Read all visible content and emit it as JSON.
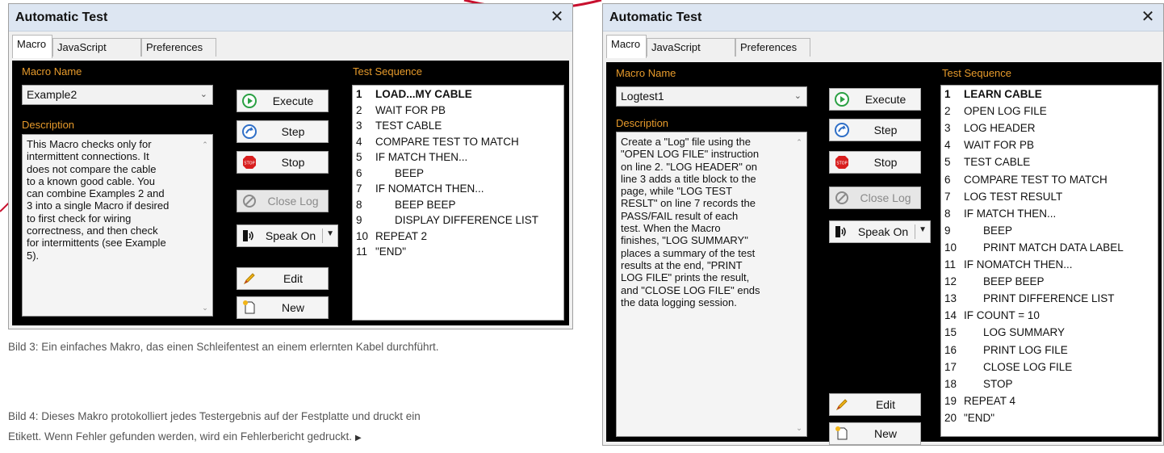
{
  "left_dialog": {
    "title": "Automatic Test",
    "close_label": "✕",
    "tabs": [
      "Macro",
      "JavaScript",
      "Preferences"
    ],
    "macro_name_label": "Macro Name",
    "macro_name_value": "Example2",
    "description_label": "Description",
    "description_lines": [
      "This Macro checks only for",
      "intermittent connections. It",
      "does not compare the cable",
      "to a known good cable. You",
      "can combine Examples 2 and",
      "3 into a single Macro if desired",
      "to first check for wiring",
      "correctness, and then check",
      "for intermittents (see Example",
      "5)."
    ],
    "buttons": {
      "execute": "Execute",
      "step": "Step",
      "stop": "Stop",
      "close_log": "Close Log",
      "speak_on": "Speak On",
      "edit": "Edit",
      "new": "New"
    },
    "test_sequence_label": "Test Sequence",
    "sequence": [
      {
        "n": "1",
        "text": "LOAD...MY CABLE",
        "indent": 0,
        "bold": true
      },
      {
        "n": "2",
        "text": "WAIT FOR PB",
        "indent": 0,
        "bold": false
      },
      {
        "n": "3",
        "text": "TEST CABLE",
        "indent": 0,
        "bold": false
      },
      {
        "n": "4",
        "text": "COMPARE TEST TO MATCH",
        "indent": 0,
        "bold": false
      },
      {
        "n": "5",
        "text": "IF MATCH THEN...",
        "indent": 0,
        "bold": false
      },
      {
        "n": "6",
        "text": "BEEP",
        "indent": 1,
        "bold": false
      },
      {
        "n": "7",
        "text": "IF NOMATCH THEN...",
        "indent": 0,
        "bold": false
      },
      {
        "n": "8",
        "text": "BEEP BEEP",
        "indent": 1,
        "bold": false
      },
      {
        "n": "9",
        "text": "DISPLAY DIFFERENCE LIST",
        "indent": 1,
        "bold": false
      },
      {
        "n": "10",
        "text": "REPEAT 2",
        "indent": 0,
        "bold": false
      },
      {
        "n": "11",
        "text": "\"END\"",
        "indent": 0,
        "bold": false
      }
    ]
  },
  "right_dialog": {
    "title": "Automatic Test",
    "close_label": "✕",
    "tabs": [
      "Macro",
      "JavaScript",
      "Preferences"
    ],
    "macro_name_label": "Macro Name",
    "macro_name_value": "Logtest1",
    "description_label": "Description",
    "description_lines": [
      "Create a \"Log\" file using the",
      "\"OPEN LOG FILE\" instruction",
      "on line 2. \"LOG HEADER\" on",
      "line 3 adds a title block to the",
      "page, while \"LOG TEST",
      "RESLT\" on line 7 records the",
      "PASS/FAIL result of each",
      "test. When the Macro",
      "finishes, \"LOG SUMMARY\"",
      "places a summary of the test",
      "results at the end, \"PRINT",
      "LOG FILE\" prints the result,",
      "and \"CLOSE LOG FILE\" ends",
      "the data logging session."
    ],
    "buttons": {
      "execute": "Execute",
      "step": "Step",
      "stop": "Stop",
      "close_log": "Close Log",
      "speak_on": "Speak On",
      "edit": "Edit",
      "new": "New"
    },
    "test_sequence_label": "Test Sequence",
    "sequence": [
      {
        "n": "1",
        "text": "LEARN CABLE",
        "indent": 0,
        "bold": true
      },
      {
        "n": "2",
        "text": "OPEN LOG FILE",
        "indent": 0,
        "bold": false
      },
      {
        "n": "3",
        "text": "LOG HEADER",
        "indent": 0,
        "bold": false
      },
      {
        "n": "4",
        "text": "WAIT FOR PB",
        "indent": 0,
        "bold": false
      },
      {
        "n": "5",
        "text": "TEST CABLE",
        "indent": 0,
        "bold": false
      },
      {
        "n": "6",
        "text": "COMPARE TEST TO MATCH",
        "indent": 0,
        "bold": false
      },
      {
        "n": "7",
        "text": "LOG TEST RESULT",
        "indent": 0,
        "bold": false
      },
      {
        "n": "8",
        "text": "IF MATCH THEN...",
        "indent": 0,
        "bold": false
      },
      {
        "n": "9",
        "text": "BEEP",
        "indent": 1,
        "bold": false
      },
      {
        "n": "10",
        "text": "PRINT MATCH DATA LABEL",
        "indent": 1,
        "bold": false
      },
      {
        "n": "11",
        "text": "IF NOMATCH THEN...",
        "indent": 0,
        "bold": false
      },
      {
        "n": "12",
        "text": "BEEP BEEP",
        "indent": 1,
        "bold": false
      },
      {
        "n": "13",
        "text": "PRINT DIFFERENCE LIST",
        "indent": 1,
        "bold": false
      },
      {
        "n": "14",
        "text": "IF COUNT = 10",
        "indent": 0,
        "bold": false
      },
      {
        "n": "15",
        "text": "LOG SUMMARY",
        "indent": 1,
        "bold": false
      },
      {
        "n": "16",
        "text": "PRINT LOG FILE",
        "indent": 1,
        "bold": false
      },
      {
        "n": "17",
        "text": "CLOSE LOG FILE",
        "indent": 1,
        "bold": false
      },
      {
        "n": "18",
        "text": "STOP",
        "indent": 1,
        "bold": false
      },
      {
        "n": "19",
        "text": "REPEAT 4",
        "indent": 0,
        "bold": false
      },
      {
        "n": "20",
        "text": "\"END\"",
        "indent": 0,
        "bold": false
      }
    ]
  },
  "captions": {
    "bild3": "Bild 3: Ein einfaches Makro, das einen Schleifentest an einem erlernten Kabel durchführt.",
    "bild4_line1": "Bild 4: Dieses Makro protokolliert jedes Testergebnis auf der Festplatte und druckt ein",
    "bild4_line2": "Etikett. Wenn Fehler gefunden werden, wird ein Fehlerbericht gedruckt."
  },
  "colors": {
    "panel_background": "#000000",
    "label_orange": "#e69a2b",
    "decor_red": "#c8102e",
    "titlebar": "#dde6f2"
  }
}
